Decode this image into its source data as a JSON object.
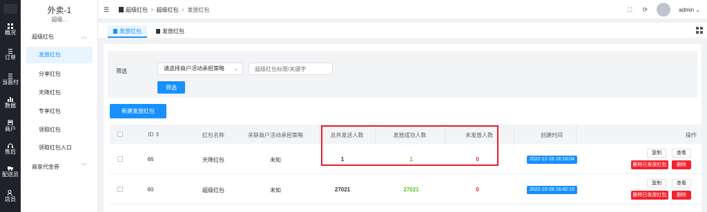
{
  "rail": {
    "items": [
      {
        "label": "概况",
        "icon": "grid-icon"
      },
      {
        "label": "订单",
        "icon": "list-icon"
      },
      {
        "label": "当面付",
        "icon": "list-icon"
      },
      {
        "label": "数据",
        "icon": "chart-icon"
      },
      {
        "label": "商户",
        "icon": "store-icon"
      },
      {
        "label": "售后",
        "icon": "headset-icon"
      },
      {
        "label": "配送员",
        "icon": "truck-icon"
      },
      {
        "label": "店员",
        "icon": "users-icon"
      }
    ]
  },
  "sidebar": {
    "brand": "外卖-1",
    "brand_sub": "超级...",
    "group1": "超级红包",
    "items": [
      {
        "label": "发放红包",
        "active": true
      },
      {
        "label": "分享红包"
      },
      {
        "label": "天降红包"
      },
      {
        "label": "专享红包"
      },
      {
        "label": "领取红包"
      },
      {
        "label": "领取红包入口"
      }
    ],
    "group2": "商家代金券"
  },
  "topbar": {
    "crumbs": [
      "超级红包",
      "超级红包",
      "发放红包"
    ],
    "user": "admin"
  },
  "tabs": [
    {
      "label": "发放红包",
      "active": true
    },
    {
      "label": "发放红包",
      "active": false
    }
  ],
  "filter": {
    "label": "筛选",
    "select_value": "请选择商户活动承担策略",
    "keyword_placeholder": "超级红包标题/关键字",
    "button": "筛选"
  },
  "new_button": "新建发放红包",
  "table": {
    "headers": {
      "id": "ID",
      "name": "红包名称",
      "policy": "关联商户活动承担策略",
      "total": "总共发送人数",
      "success": "发放成功人数",
      "unsent": "未发放人数",
      "created": "创建时间",
      "actions": "操作"
    },
    "rows": [
      {
        "id": "66",
        "name": "天降红包",
        "policy": "未知",
        "total": "1",
        "success": "1",
        "unsent": "0",
        "created": "2022-12-16 16:16:04"
      },
      {
        "id": "60",
        "name": "超级红包",
        "policy": "未知",
        "total": "27021",
        "success": "27021",
        "unsent": "0",
        "created": "2022-10-28 16:42:15"
      }
    ],
    "actions": {
      "copy": "复制",
      "view": "查看",
      "delete_sent": "删除已发放红包",
      "delete": "删除"
    }
  },
  "colors": {
    "primary": "#1890ff",
    "danger": "#f5222d",
    "success": "#52c41a",
    "highlight": "#e8192c"
  }
}
